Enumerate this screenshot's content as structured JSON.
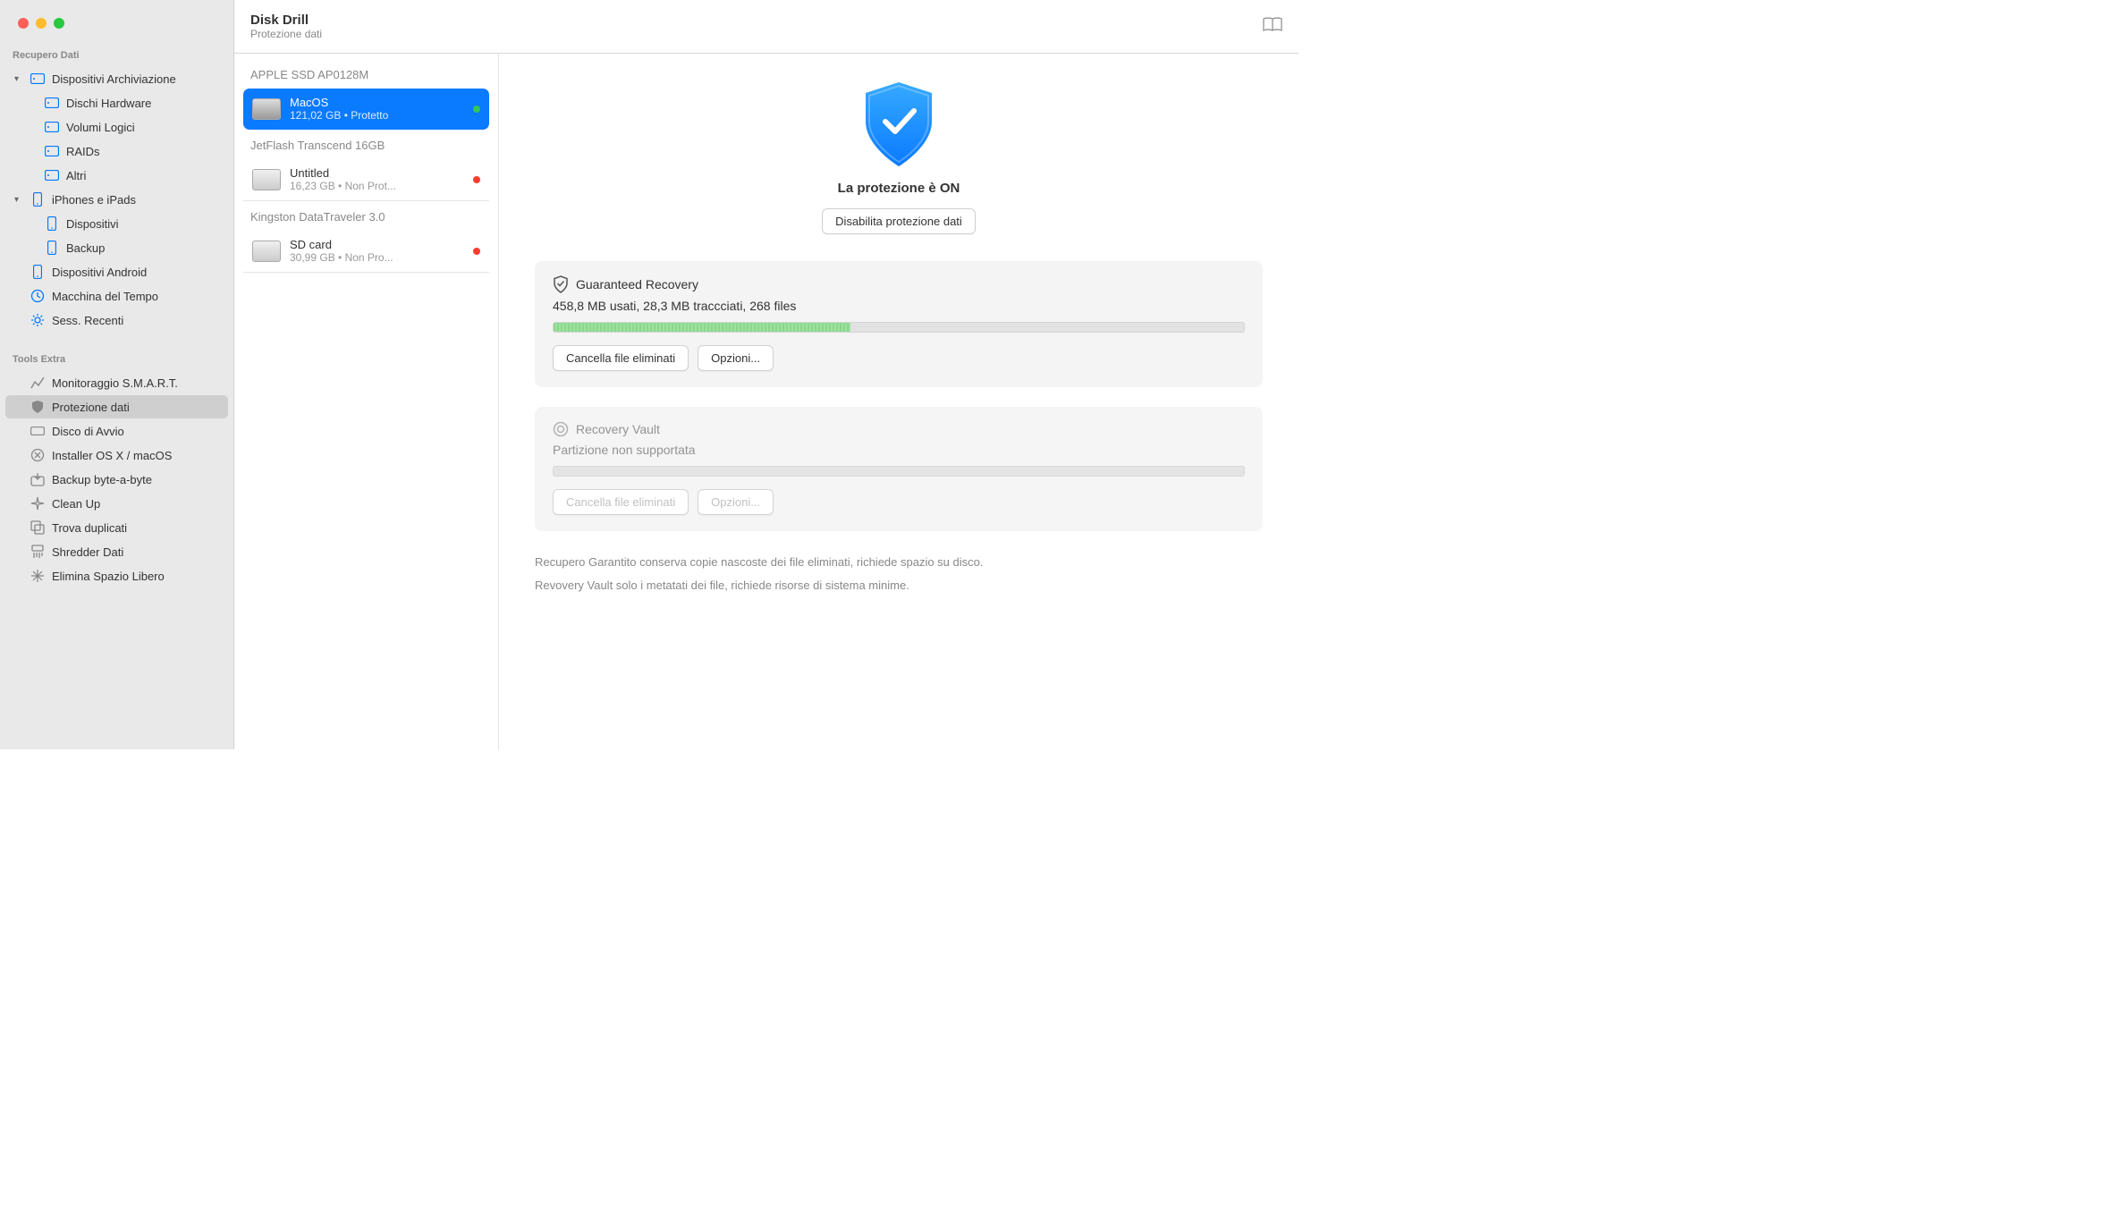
{
  "header": {
    "title": "Disk Drill",
    "subtitle": "Protezione dati"
  },
  "sidebar": {
    "section1": "Recupero Dati",
    "storage": {
      "label": "Dispositivi Archiviazione",
      "hardware": "Dischi Hardware",
      "logical": "Volumi Logici",
      "raids": "RAIDs",
      "other": "Altri"
    },
    "iphones": {
      "label": "iPhones e iPads",
      "devices": "Dispositivi",
      "backup": "Backup"
    },
    "android": "Dispositivi Android",
    "timemachine": "Macchina del Tempo",
    "recent": "Sess. Recenti",
    "section2": "Tools Extra",
    "smart": "Monitoraggio S.M.A.R.T.",
    "protection": "Protezione dati",
    "bootdisk": "Disco di Avvio",
    "installer": "Installer OS X / macOS",
    "bytebackup": "Backup byte-a-byte",
    "cleanup": "Clean Up",
    "duplicates": "Trova duplicati",
    "shredder": "Shredder Dati",
    "freespace": "Elimina Spazio Libero"
  },
  "devices": {
    "g1": "APPLE SSD AP0128M",
    "d1": {
      "name": "MacOS",
      "sub": "121,02 GB • Protetto"
    },
    "g2": "JetFlash Transcend 16GB",
    "d2": {
      "name": "Untitled",
      "sub": "16,23 GB • Non Prot..."
    },
    "g3": "Kingston DataTraveler 3.0",
    "d3": {
      "name": "SD card",
      "sub": "30,99 GB • Non Pro..."
    }
  },
  "main": {
    "shield_title": "La protezione è ON",
    "disable_btn": "Disabilita protezione dati",
    "gr": {
      "title": "Guaranteed Recovery",
      "stats": "458,8 MB usati, 28,3 MB traccciati, 268 files",
      "progress_pct": 43,
      "btn_clear": "Cancella file eliminati",
      "btn_opts": "Opzioni..."
    },
    "rv": {
      "title": "Recovery Vault",
      "stats": "Partizione non supportata",
      "btn_clear": "Cancella file eliminati",
      "btn_opts": "Opzioni..."
    },
    "note1": "Recupero Garantito conserva copie nascoste dei file eliminati, richiede spazio su disco.",
    "note2": "Revovery Vault solo i metatati dei file, richiede risorse di sistema minime."
  }
}
